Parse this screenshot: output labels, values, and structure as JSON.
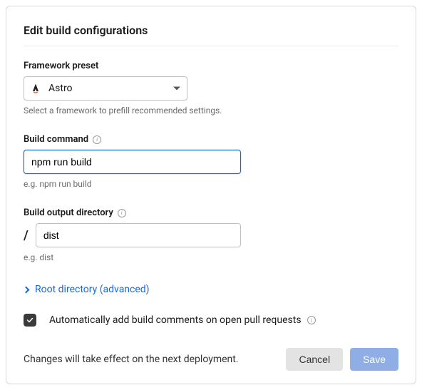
{
  "title": "Edit build configurations",
  "framework": {
    "label": "Framework preset",
    "value": "Astro",
    "hint": "Select a framework to prefill recommended settings."
  },
  "build_command": {
    "label": "Build command",
    "value": "npm run build",
    "hint": "e.g. npm run build"
  },
  "output_dir": {
    "label": "Build output directory",
    "prefix": "/",
    "value": "dist",
    "hint": "e.g. dist"
  },
  "advanced": {
    "label": "Root directory (advanced)"
  },
  "auto_comments": {
    "checked": true,
    "label": "Automatically add build comments on open pull requests"
  },
  "footer": {
    "text": "Changes will take effect on the next deployment.",
    "cancel": "Cancel",
    "save": "Save"
  }
}
